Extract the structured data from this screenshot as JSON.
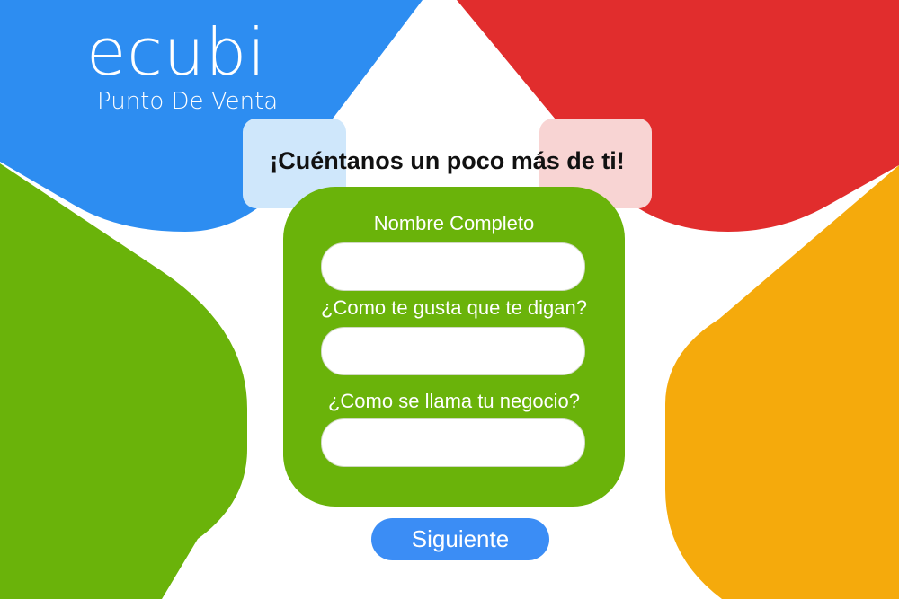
{
  "brand": {
    "name": "ecubi",
    "subtitle": "Punto De Venta"
  },
  "headline": {
    "text": "¡Cuéntanos un poco más de ti!"
  },
  "form": {
    "fields": [
      {
        "label": "Nombre Completo",
        "value": ""
      },
      {
        "label": "¿Como te gusta que te digan?",
        "value": ""
      },
      {
        "label": "¿Como se llama tu negocio?",
        "value": ""
      }
    ],
    "submit_label": "Siguiente"
  },
  "colors": {
    "blue": "#2d8df1",
    "red": "#e12d2d",
    "green": "#6ab30a",
    "orange": "#f5aa0c",
    "headline_left": "#cfe7fb",
    "headline_right": "#f8d4d3",
    "button": "#3b8df5"
  }
}
